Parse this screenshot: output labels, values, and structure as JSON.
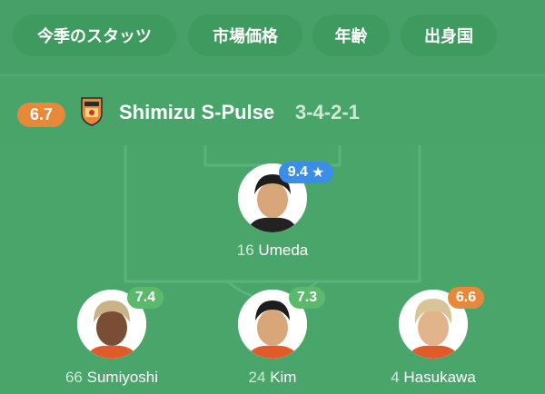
{
  "filters": [
    {
      "label": "今季のスタッツ"
    },
    {
      "label": "市場価格"
    },
    {
      "label": "年齢"
    },
    {
      "label": "出身国"
    }
  ],
  "team": {
    "rating": "6.7",
    "name": "Shimizu S-Pulse",
    "formation": "3-4-2-1",
    "crest_icon": "shimizu-crest-icon"
  },
  "players": [
    {
      "number": "16",
      "name": "Umeda",
      "rating": "9.4",
      "rating_color": "#3a8ee8",
      "star": "★"
    },
    {
      "number": "66",
      "name": "Sumiyoshi",
      "rating": "7.4",
      "rating_color": "#5cb96b"
    },
    {
      "number": "24",
      "name": "Kim",
      "rating": "7.3",
      "rating_color": "#5cb96b"
    },
    {
      "number": "4",
      "name": "Hasukawa",
      "rating": "6.6",
      "rating_color": "#e8893a"
    }
  ],
  "colors": {
    "pitch": "#4aa56b",
    "badge_orange": "#e8893a",
    "badge_green": "#5cb96b",
    "badge_blue": "#3a8ee8"
  }
}
